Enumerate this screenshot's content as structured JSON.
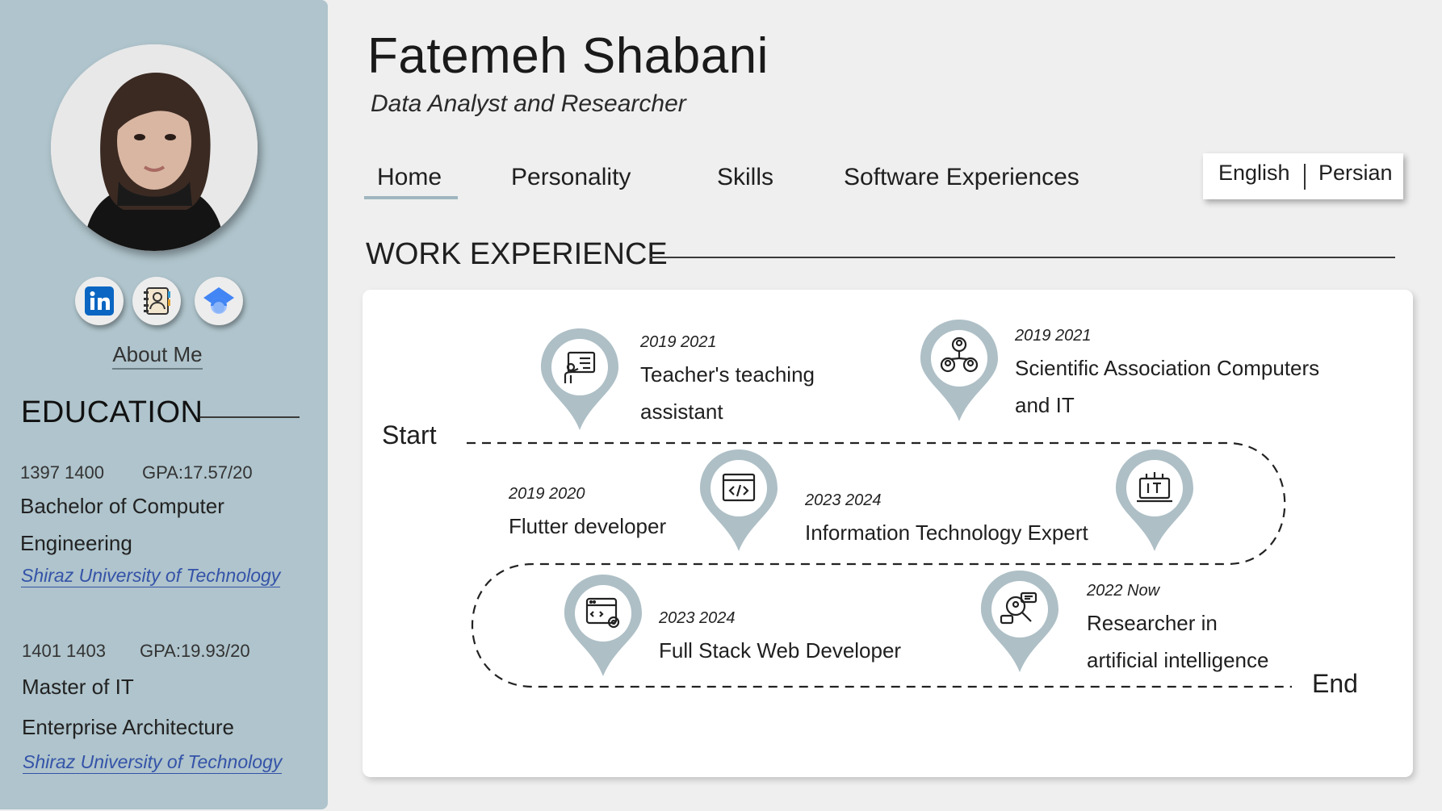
{
  "profile": {
    "name": "Fatemeh Shabani",
    "title": "Data Analyst and Researcher",
    "about_link": "About Me",
    "social_icons": [
      "linkedin-icon",
      "contact-book-icon",
      "scholar-cap-icon"
    ]
  },
  "nav": {
    "items": [
      "Home",
      "Personality",
      "Skills",
      "Software Experiences"
    ],
    "active": "Home"
  },
  "language": {
    "options": [
      "English",
      "Persian"
    ]
  },
  "education": {
    "heading": "EDUCATION",
    "entries": [
      {
        "years": "1397  1400",
        "gpa": "GPA:17.57/20",
        "degree_line1": "Bachelor of Computer",
        "degree_line2": "Engineering",
        "university": "Shiraz University of Technology"
      },
      {
        "years": "1401  1403",
        "gpa": "GPA:19.93/20",
        "degree_line1": "Master of IT",
        "degree_line2": "Enterprise Architecture",
        "university": "Shiraz University of Technology"
      }
    ]
  },
  "work": {
    "heading": "WORK EXPERIENCE",
    "start_label": "Start",
    "end_label": "End",
    "jobs": [
      {
        "years": "2019  2021",
        "title_line1": "Teacher's teaching",
        "title_line2": "assistant",
        "icon": "presentation-icon"
      },
      {
        "years": "2019  2021",
        "title_line1": "Scientific Association Computers",
        "title_line2": "and IT",
        "icon": "people-network-icon"
      },
      {
        "years": "2019  2020",
        "title_line1": "Flutter developer",
        "title_line2": "",
        "icon": "code-window-icon"
      },
      {
        "years": "2023  2024",
        "title_line1": "Information Technology Expert",
        "title_line2": "",
        "icon": "it-monitor-icon"
      },
      {
        "years": "2023  2024",
        "title_line1": "Full Stack Web Developer",
        "title_line2": "",
        "icon": "web-settings-icon"
      },
      {
        "years": "2022   Now",
        "title_line1": "Researcher in",
        "title_line2": "artificial intelligence",
        "icon": "ai-research-icon"
      }
    ]
  },
  "colors": {
    "sidebar": "#afc4cc",
    "pin": "#aebfc6",
    "link": "#3453a8",
    "background": "#efefef"
  }
}
